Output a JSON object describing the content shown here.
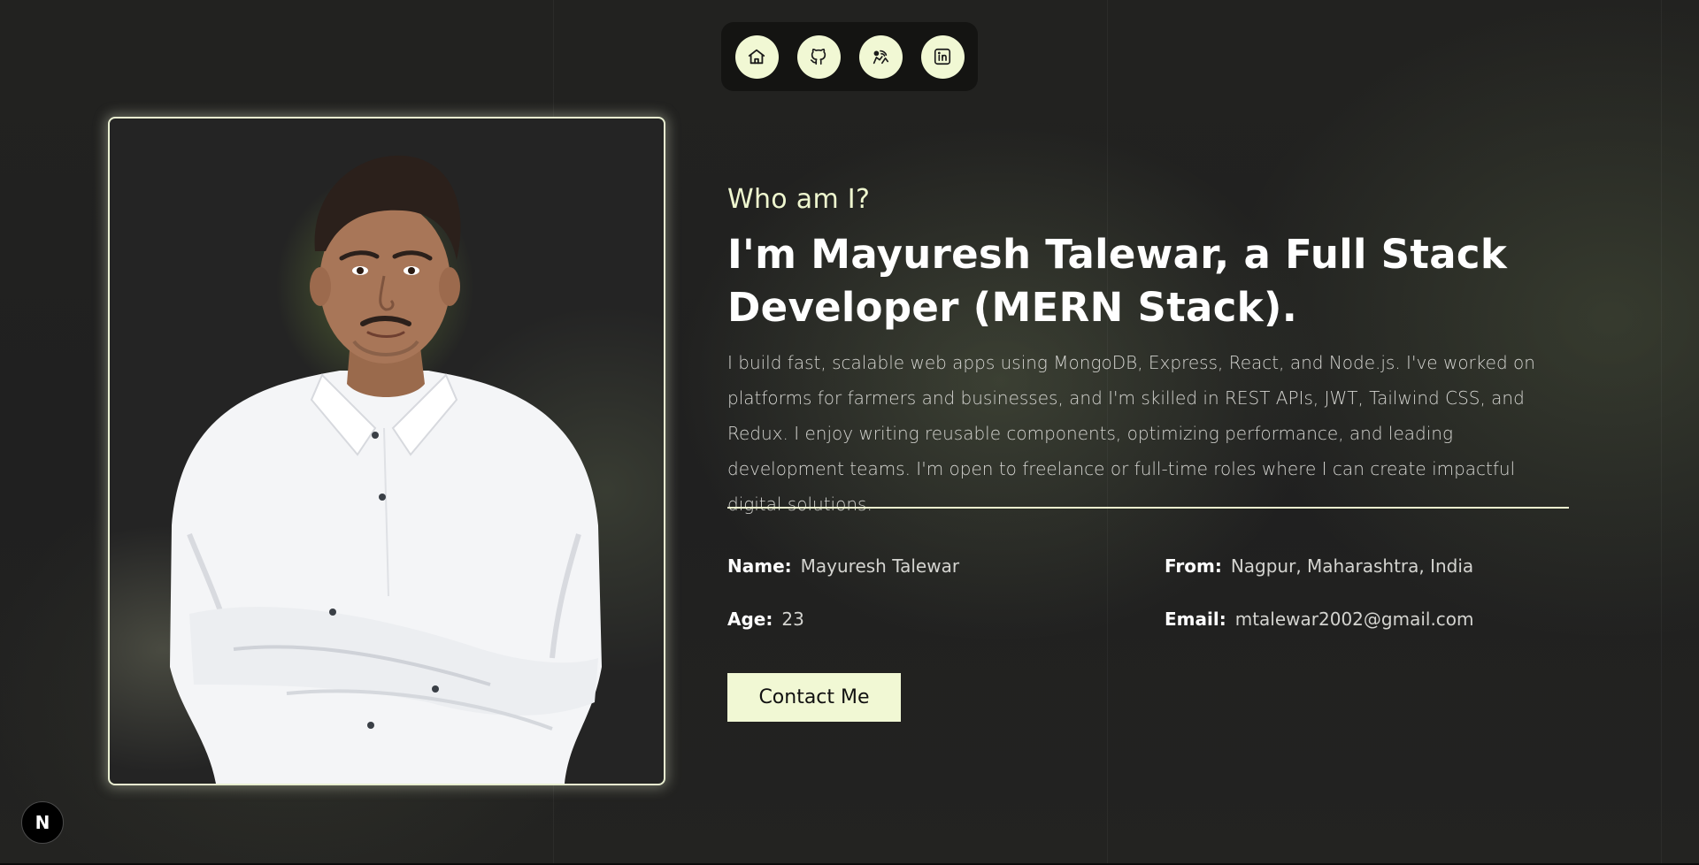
{
  "nav": {
    "items": [
      {
        "icon": "home-icon"
      },
      {
        "icon": "github-icon"
      },
      {
        "icon": "skills-icon"
      },
      {
        "icon": "linkedin-icon"
      }
    ]
  },
  "about": {
    "eyebrow": "Who am I?",
    "headline_line1": "I'm Mayuresh Talewar, a Full Stack",
    "headline_line2": "Developer (MERN Stack).",
    "bio": "I build fast, scalable web apps using MongoDB, Express, React, and Node.js. I've worked on platforms for farmers and businesses, and I'm skilled in REST APIs, JWT, Tailwind CSS, and Redux. I enjoy writing reusable components, optimizing performance, and leading development teams. I'm open to freelance or full-time roles where I can create impactful digital solutions.",
    "info": {
      "name_label": "Name:",
      "name_value": "Mayuresh Talewar",
      "from_label": "From:",
      "from_value": "Nagpur, Maharashtra, India",
      "age_label": "Age:",
      "age_value": "23",
      "email_label": "Email:",
      "email_value": "mtalewar2002@gmail.com"
    },
    "contact_button": "Contact Me"
  },
  "badge": {
    "letter": "N"
  },
  "colors": {
    "accent": "#f1f8d4",
    "background": "#212121",
    "nav_background": "#141412"
  }
}
